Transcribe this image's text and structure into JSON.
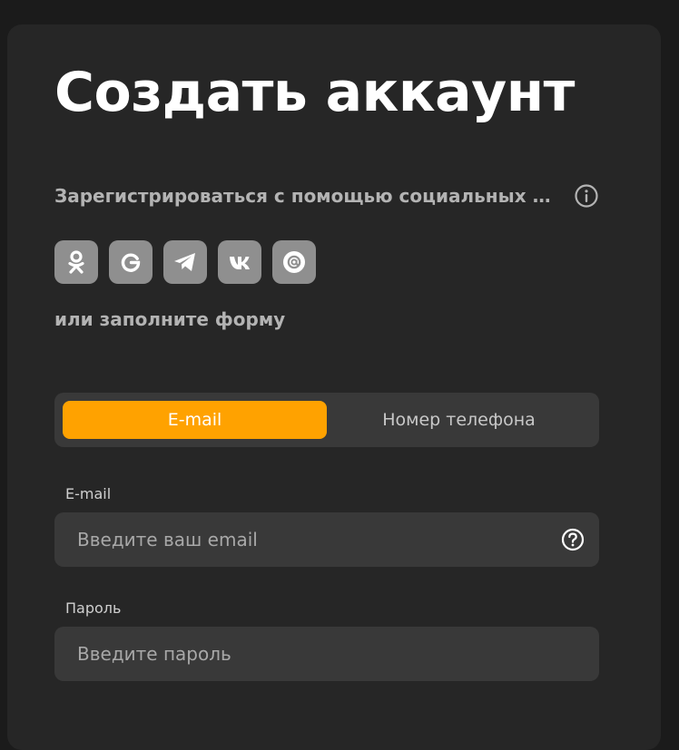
{
  "form": {
    "title": "Создать аккаунт",
    "social_label": "Зарегистрироваться с помощью социальных сетей",
    "social_icons": [
      "odnoklassniki-icon",
      "google-icon",
      "telegram-icon",
      "vk-icon",
      "mail-ru-icon"
    ],
    "or_label": "или заполните форму",
    "tabs": [
      {
        "label": "E-mail",
        "active": true
      },
      {
        "label": "Номер телефона",
        "active": false
      }
    ],
    "email": {
      "label": "E-mail",
      "placeholder": "Введите ваш email",
      "value": ""
    },
    "password": {
      "label": "Пароль",
      "placeholder": "Введите пароль",
      "value": ""
    }
  },
  "colors": {
    "background": "#1b1b1b",
    "card": "#262626",
    "accent": "#ffa200",
    "field": "#393939",
    "social_button": "#8f8f8f"
  }
}
